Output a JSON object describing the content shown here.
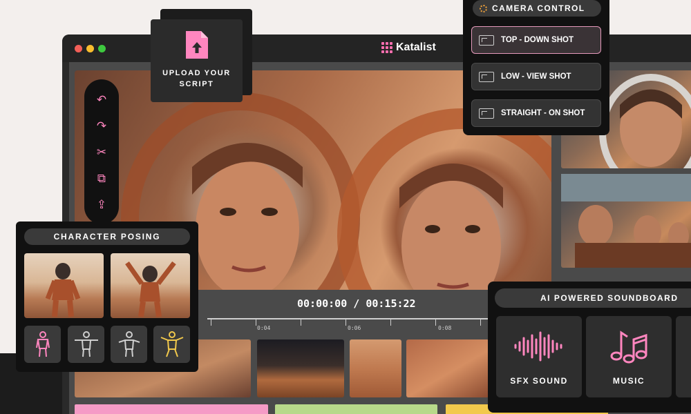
{
  "app": {
    "brand": "Katalist"
  },
  "upload": {
    "label": "UPLOAD YOUR SCRIPT"
  },
  "toolbar": {
    "tools": [
      "undo-icon",
      "redo-icon",
      "scissors-icon",
      "duplicate-icon",
      "upload-icon"
    ]
  },
  "camera": {
    "title": "CAMERA CONTROL",
    "options": [
      {
        "label": "TOP - DOWN SHOT",
        "active": true
      },
      {
        "label": "LOW - VIEW SHOT",
        "active": false
      },
      {
        "label": "STRAIGHT - ON SHOT",
        "active": false
      }
    ]
  },
  "posing": {
    "title": "CHARACTER POSING",
    "poses": [
      "pose-standing-icon",
      "pose-t-pose-icon",
      "pose-arms-out-icon",
      "pose-jumping-icon"
    ]
  },
  "timeline": {
    "timecode": "00:00:00 / 00:15:22",
    "ticks": [
      "0:04",
      "0:06",
      "0:08"
    ]
  },
  "soundboard": {
    "title": "AI POWERED SOUNDBOARD",
    "cards": [
      {
        "label": "SFX SOUND",
        "icon": "sound-wave-icon"
      },
      {
        "label": "MUSIC",
        "icon": "music-notes-icon"
      }
    ]
  },
  "colors": {
    "accent_pink": "#ff86bf",
    "accent_orange": "#f2a33a",
    "accent_yellow": "#f2c94c",
    "track_pink": "#f59bc6",
    "track_green": "#b8d98a",
    "track_yellow": "#f2c94c"
  }
}
